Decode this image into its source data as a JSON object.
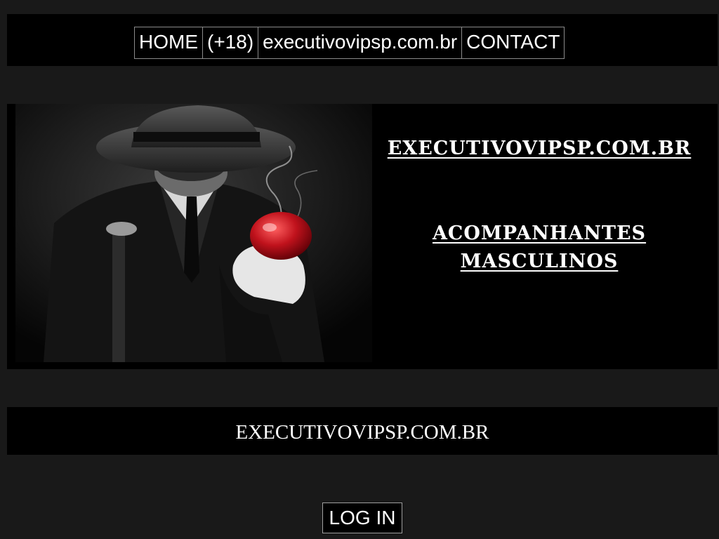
{
  "nav": {
    "items": [
      {
        "label": "HOME"
      },
      {
        "label": "(+18)"
      },
      {
        "label": "executivovipsp.com.br"
      },
      {
        "label": "CONTACT"
      }
    ]
  },
  "hero": {
    "title": "EXECUTIVOVIPSP.COM.BR",
    "subtitle_line1": "ACOMPANHANTES",
    "subtitle_line2": "MASCULINOS",
    "image_subject": "man in fedora hat and suit holding red apple"
  },
  "footer_band": {
    "text": "EXECUTIVOVIPSP.COM.BR"
  },
  "login": {
    "label": "LOG IN"
  },
  "colors": {
    "page_background": "#191919",
    "panel_background": "#000000",
    "text": "#ffffff",
    "border": "#8a8a8a",
    "apple": "#c0121c"
  }
}
